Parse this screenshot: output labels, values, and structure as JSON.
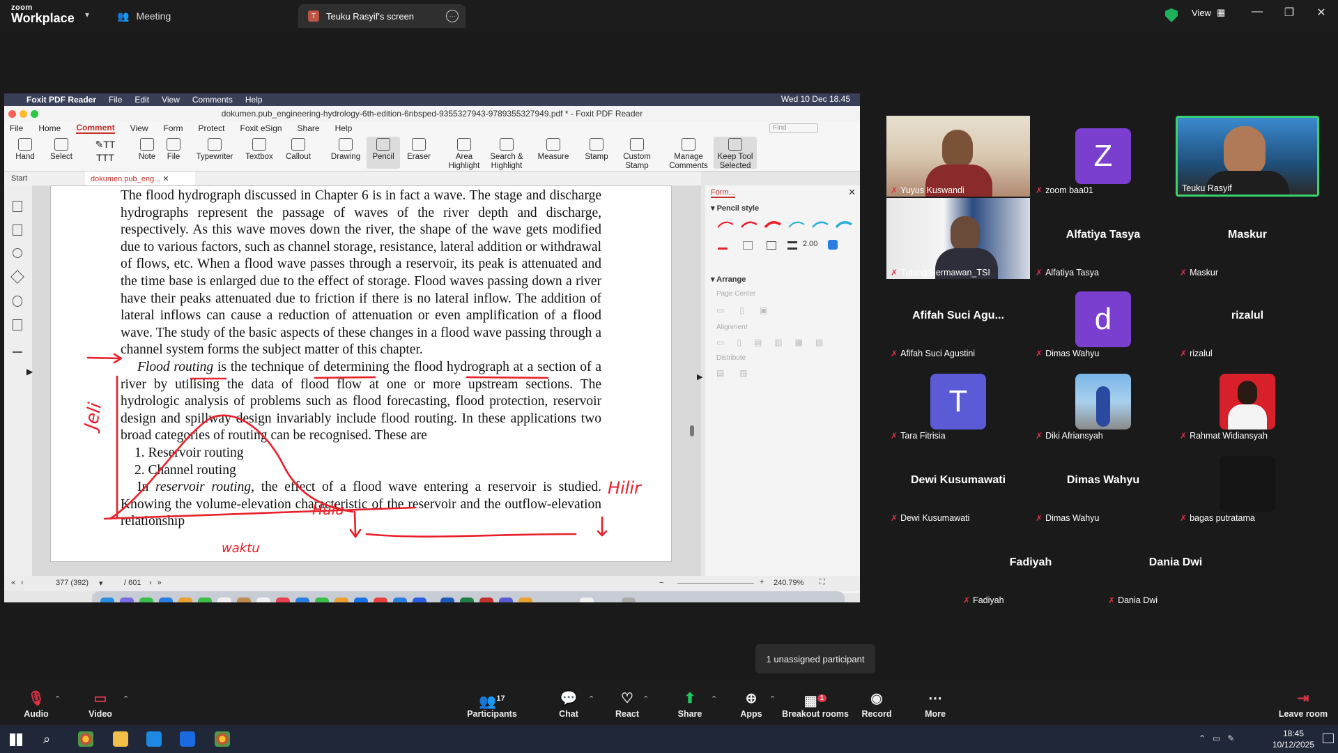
{
  "zoom": {
    "brand_top": "zoom",
    "brand": "Workplace",
    "meeting_tab": "Meeting",
    "screen_tab": "Teuku Rasyif's screen",
    "screen_tab_initial": "T",
    "view_label": "View",
    "accent": "#0b5cff",
    "security_color": "#1fb05c"
  },
  "mac": {
    "apple_menu": [
      "Foxit PDF Reader",
      "File",
      "Edit",
      "View",
      "Comments",
      "Help"
    ],
    "clock": "Wed 10 Dec  18.45"
  },
  "foxit": {
    "title": "dokumen.pub_engineering-hydrology-6th-edition-6nbsped-9355327943-9789355327949.pdf * - Foxit PDF Reader",
    "menu": [
      "File",
      "Home",
      "Comment",
      "View",
      "Form",
      "Protect",
      "Foxit eSign",
      "Share",
      "Help"
    ],
    "active_menu": "Comment",
    "find_placeholder": "Find",
    "ribbon": [
      "Hand",
      "Select",
      "Note",
      "File",
      "Typewriter",
      "Textbox",
      "Callout",
      "Drawing",
      "Pencil",
      "Eraser",
      "Area Highlight",
      "Search & Highlight",
      "Measure",
      "Stamp",
      "Custom Stamp",
      "Manage Comments",
      "Keep Tool Selected"
    ],
    "tabs": {
      "start": "Start",
      "doc": "dokumen.pub_eng..."
    },
    "page_indicator": "377 (392)",
    "page_total": "/ 601",
    "zoom_level": "240.79%",
    "panel": {
      "tab": "Form...",
      "pencil_style": "Pencil style",
      "thickness": "2.00",
      "arrange": "Arrange",
      "page_center": "Page Center",
      "alignment": "Alignment",
      "distribute": "Distribute"
    }
  },
  "pdf": {
    "para1": "The flood hydrograph discussed in Chapter 6 is in fact a wave. The stage and discharge hydrographs represent the passage of waves of the river depth and discharge, respectively. As this wave moves down the river, the shape of the wave gets modified due to various factors, such as channel storage, resistance, lateral addition or withdrawal of flows, etc. When a flood wave passes through a reservoir, its peak is attenuated and the time base is enlarged due to the effect of storage. Flood waves passing down a river have their peaks attenuated due to friction if there is no lateral inflow. The addition of lateral inflows can cause a reduction of attenuation or even amplification of a flood wave. The study of the basic aspects of these changes in a flood wave passing through a channel system forms the subject matter of this chapter.",
    "para2_term": "Flood routing",
    "para2": " is the technique of determining the flood hydrograph at a section of a river by utilising the data of flood flow at one or more upstream sections. The hydrologic analysis of problems such as flood forecasting, flood protection, reservoir design and spillway design invariably include flood routing. In these applications two broad categories of routing can be recognised. These are",
    "list": [
      "1.  Reservoir routing",
      "2.  Channel routing"
    ],
    "para3_a": "In ",
    "para3_term": "reservoir routing,",
    "para3": " the effect of a flood wave entering a reservoir is studied. Knowing the volume-elevation characteristic of the reservoir and the outflow-elevation relationship",
    "ink_labels": [
      "Hilir",
      "Hulu",
      "waktu",
      "Jeli"
    ],
    "ink_color": "#e8202a"
  },
  "participants": [
    {
      "name": "Yuyus Kuswandi",
      "type": "video"
    },
    {
      "name": "zoom baa01",
      "type": "avatar",
      "initial": "Z",
      "color": "#7b3fd0"
    },
    {
      "name": "Teuku Rasyif",
      "type": "video",
      "active": true
    },
    {
      "name": "Tutang Hermawan_TSI",
      "type": "video"
    },
    {
      "name": "Alfatiya Tasya",
      "type": "name",
      "display": "Alfatiya Tasya"
    },
    {
      "name": "Maskur",
      "type": "name",
      "display": "Maskur"
    },
    {
      "name": "Afifah Suci Agustini",
      "type": "name",
      "display": "Afifah Suci Agu..."
    },
    {
      "name": "Dimas Wahyu",
      "type": "avatar",
      "initial": "d",
      "color": "#7b3fd0"
    },
    {
      "name": "rizalul",
      "type": "name",
      "display": "rizalul"
    },
    {
      "name": "Tara Fitrisia",
      "type": "avatar",
      "initial": "T",
      "color": "#5b5bd6"
    },
    {
      "name": "Diki Afriansyah",
      "type": "photo"
    },
    {
      "name": "Rahmat Widiansyah",
      "type": "photo"
    },
    {
      "name": "Dewi Kusumawati",
      "type": "name",
      "display": "Dewi Kusumawati"
    },
    {
      "name": "Dimas Wahyu",
      "type": "name",
      "display": "Dimas Wahyu"
    },
    {
      "name": "bagas putratama",
      "type": "dark"
    },
    {
      "name": "Fadiyah",
      "type": "name",
      "display": "Fadiyah"
    },
    {
      "name": "Dania Dwi",
      "type": "name",
      "display": "Dania Dwi"
    }
  ],
  "unassigned": "1 unassigned participant",
  "toolbar": {
    "audio": "Audio",
    "video": "Video",
    "participants": "Participants",
    "participants_count": "17",
    "chat": "Chat",
    "react": "React",
    "share": "Share",
    "apps": "Apps",
    "breakout": "Breakout rooms",
    "breakout_badge": "1",
    "record": "Record",
    "more": "More",
    "leave": "Leave room"
  },
  "taskbar": {
    "time": "18:45",
    "date": "10/12/2025"
  }
}
